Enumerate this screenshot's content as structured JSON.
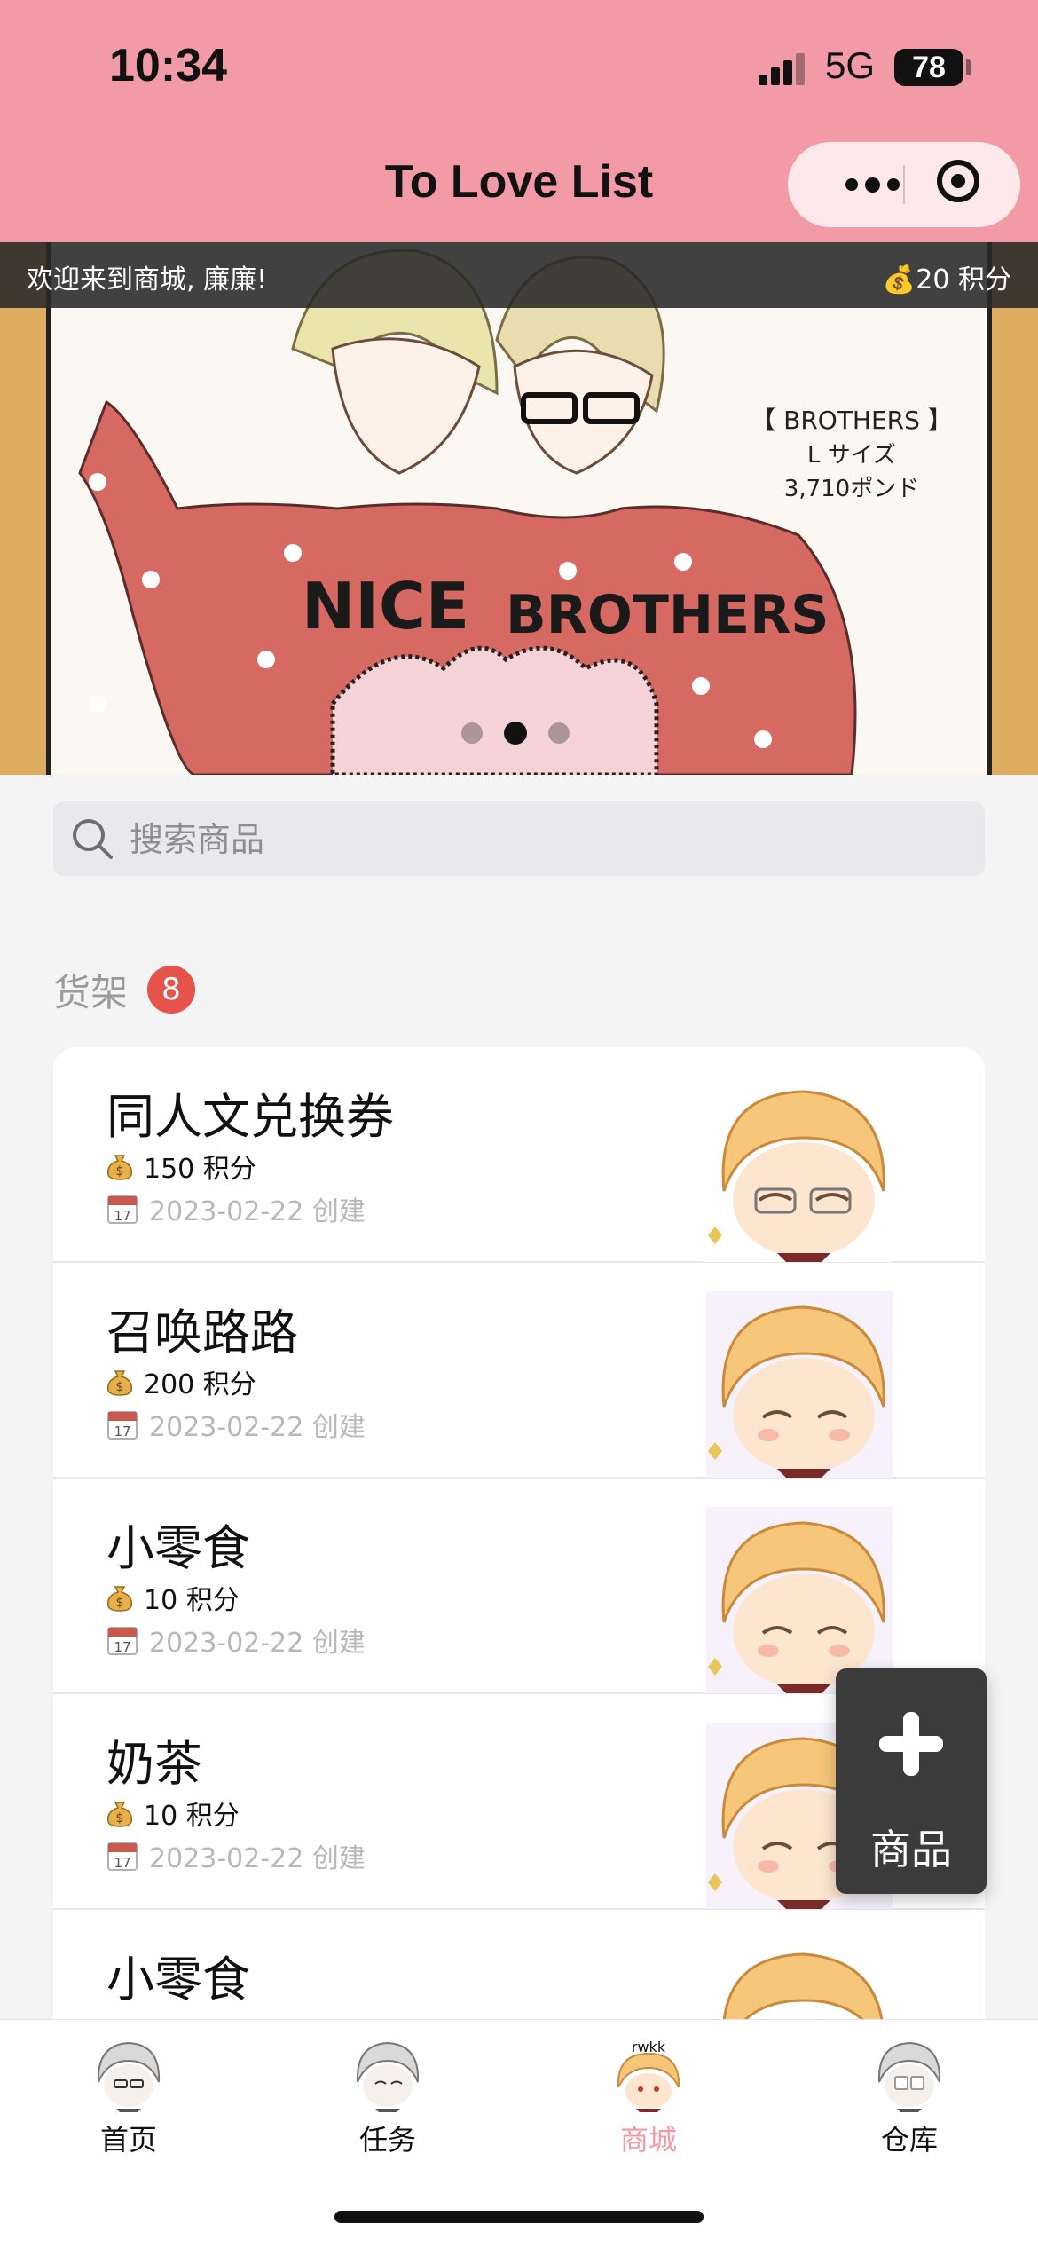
{
  "status": {
    "time": "10:34",
    "network": "5G",
    "battery": "78"
  },
  "nav": {
    "title": "To Love List"
  },
  "banner": {
    "welcome": "欢迎来到商城, 廉廉!",
    "points": "💰20 积分",
    "art_text_1": "NICE",
    "art_text_2": "BROTHERS",
    "art_caption_1": "【 BROTHERS 】",
    "art_caption_2": "L サイズ",
    "art_caption_3": "3,710ポンド",
    "slide_count": 3,
    "active_slide": 2
  },
  "search": {
    "placeholder": "搜索商品",
    "value": ""
  },
  "shelf": {
    "title": "货架",
    "count": "8",
    "items": [
      {
        "name": "同人文兑换券",
        "points": "150 积分",
        "date": "2023-02-22 创建"
      },
      {
        "name": "召唤路路",
        "points": "200 积分",
        "date": "2023-02-22 创建"
      },
      {
        "name": "小零食",
        "points": "10 积分",
        "date": "2023-02-22 创建"
      },
      {
        "name": "奶茶",
        "points": "10 积分",
        "date": "2023-02-22 创建"
      },
      {
        "name": "小零食",
        "points": "",
        "date": ""
      }
    ]
  },
  "fab": {
    "label": "商品",
    "icon": "plus-icon"
  },
  "tabs": [
    {
      "label": "首页",
      "icon": "home-avatar-icon"
    },
    {
      "label": "任务",
      "icon": "task-avatar-icon"
    },
    {
      "label": "商城",
      "icon": "shop-avatar-icon",
      "active": true,
      "avatar_text": "rwkk"
    },
    {
      "label": "仓库",
      "icon": "warehouse-avatar-icon"
    }
  ],
  "colors": {
    "accent": "#f29aa6",
    "badge": "#e5534b",
    "banner_bg": "#dfad60",
    "fab_bg": "#3b3b3b"
  }
}
